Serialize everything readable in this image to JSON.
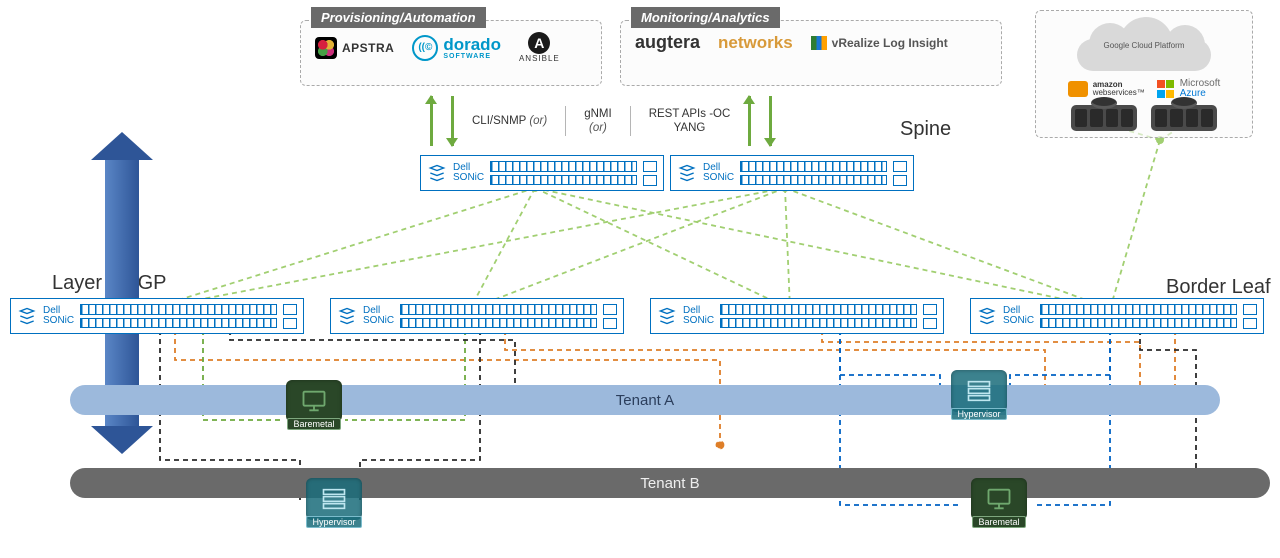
{
  "sections": {
    "provisioning": {
      "title": "Provisioning/Automation",
      "vendors": {
        "apstra": "APSTRA",
        "dorado": "dorado",
        "dorado_sub": "SOFTWARE",
        "ansible": "ANSIBLE"
      }
    },
    "monitoring": {
      "title": "Monitoring/Analytics",
      "vendors": {
        "augtera": "augtera",
        "networks": "networks",
        "vrealize": "vRealize Log Insight"
      }
    }
  },
  "protocols": {
    "col1_line1": "CLI/SNMP",
    "col1_line2": "(or)",
    "col2_line1": "gNMI",
    "col2_line2": "(or)",
    "col3_line1": "REST APIs -OC",
    "col3_line2": "YANG"
  },
  "labels": {
    "spine": "Spine",
    "border_leaf": "Border Leaf",
    "layer3": "Layer 3/BGP"
  },
  "switch": {
    "brand": "Dell",
    "os": "SONiC"
  },
  "tenants": {
    "a": "Tenant A",
    "b": "Tenant B"
  },
  "hosts": {
    "baremetal": "Baremetal",
    "hypervisor": "Hypervisor"
  },
  "cloud": {
    "gcp": "Google Cloud Platform",
    "aws_l1": "amazon",
    "aws_l2": "webservices™",
    "azure": "Microsoft",
    "azure2": "Azure"
  }
}
